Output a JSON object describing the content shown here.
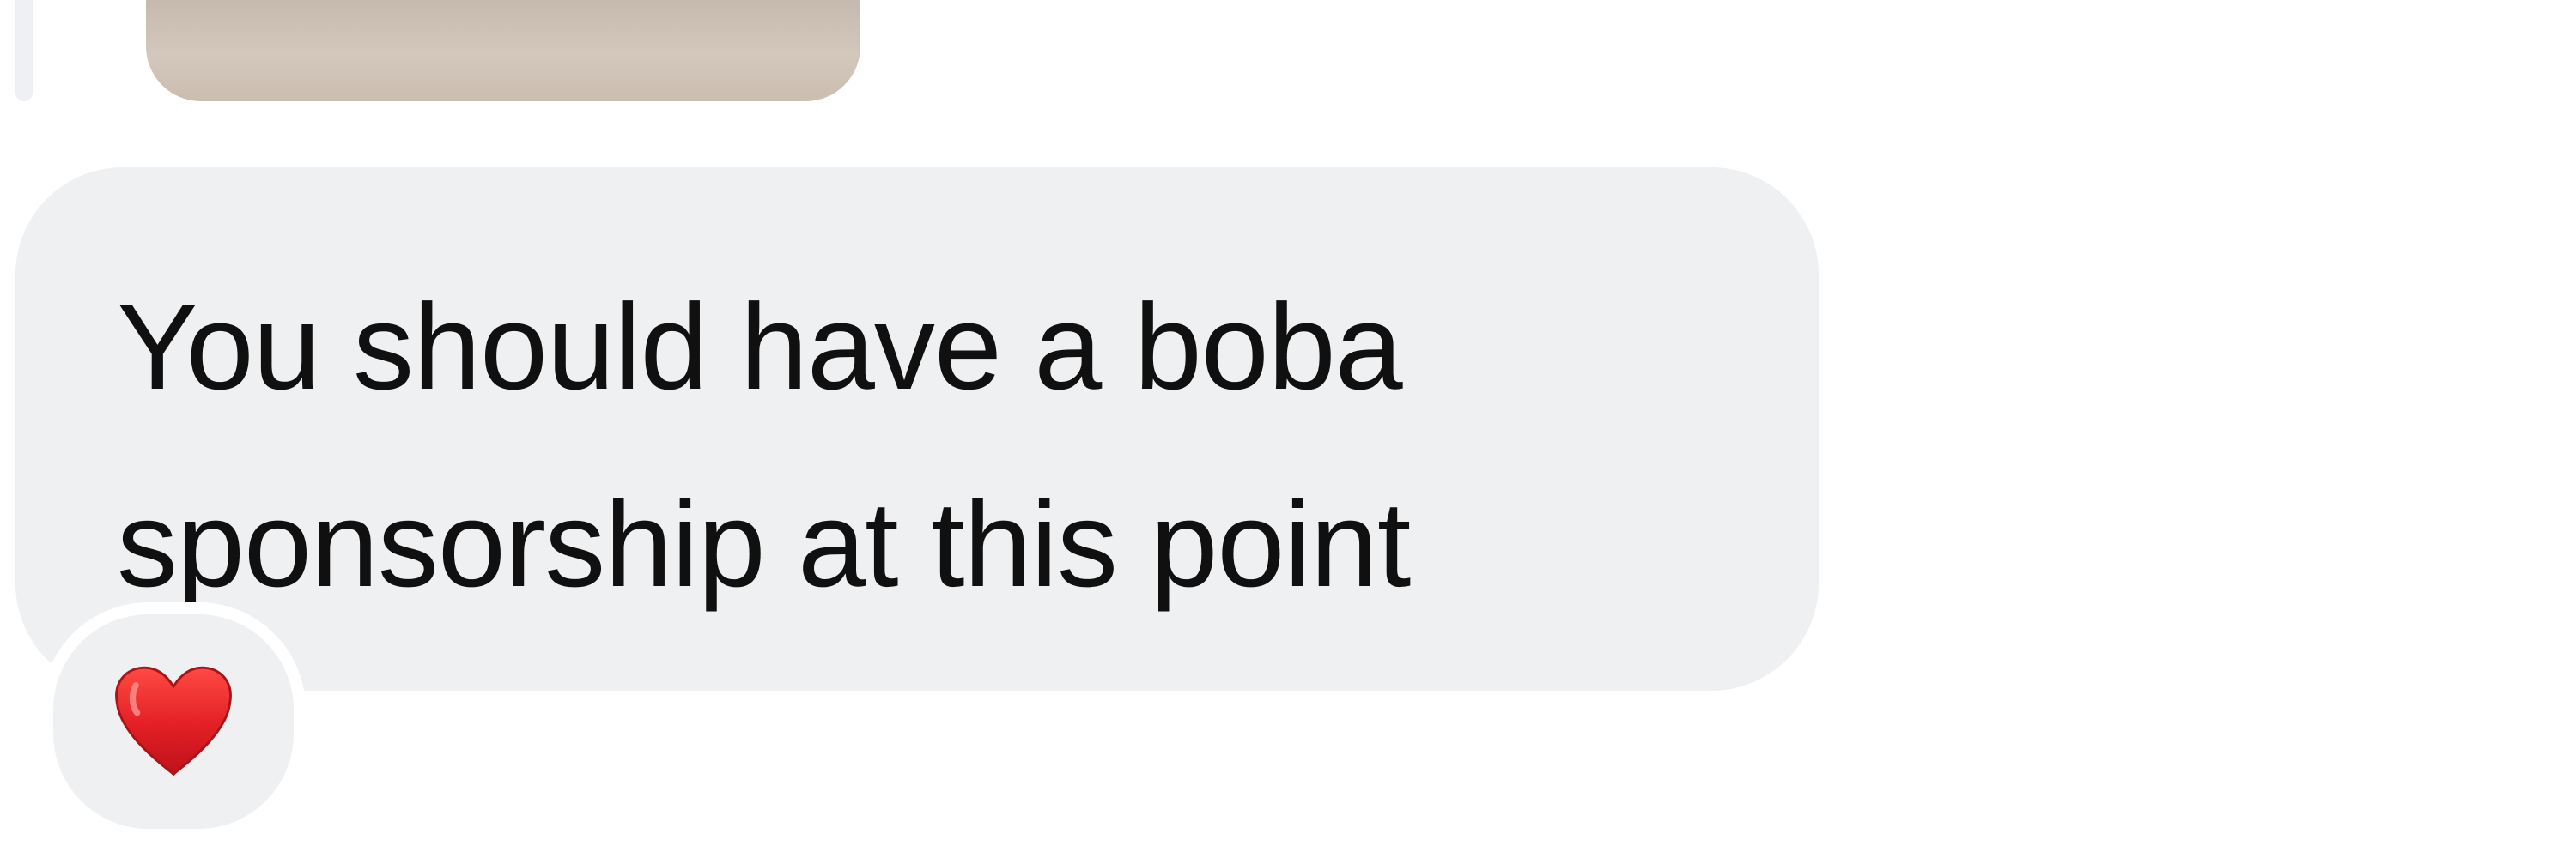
{
  "conversation": {
    "previous_attachment": {
      "type": "photo"
    },
    "message": {
      "text": "You should have a boba\nsponsorship at this point"
    },
    "reaction": {
      "emoji": "❤️",
      "icon": "red-heart-icon",
      "color": "#d7191f"
    },
    "colors": {
      "bubble": "#eff0f2",
      "text": "#101010",
      "background": "#ffffff"
    }
  }
}
